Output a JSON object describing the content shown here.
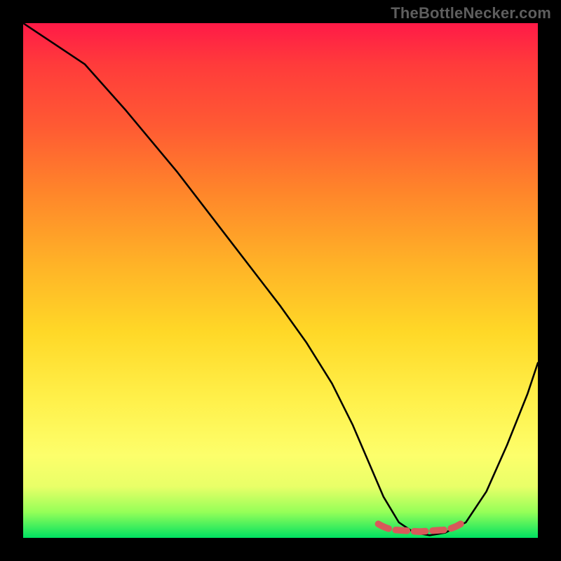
{
  "watermark": "TheBottleNecker.com",
  "chart_data": {
    "type": "line",
    "title": "",
    "xlabel": "",
    "ylabel": "",
    "xlim": [
      0,
      100
    ],
    "ylim": [
      0,
      100
    ],
    "series": [
      {
        "name": "bottleneck-curve",
        "x": [
          0,
          3,
          6,
          12,
          20,
          30,
          40,
          50,
          55,
          60,
          64,
          67,
          70,
          73,
          76,
          79,
          82,
          86,
          90,
          94,
          98,
          100
        ],
        "values": [
          100,
          98,
          96,
          92,
          83,
          71,
          58,
          45,
          38,
          30,
          22,
          15,
          8,
          3,
          1,
          0.5,
          1,
          3,
          9,
          18,
          28,
          34
        ]
      }
    ],
    "accent": {
      "name": "optimal-zone",
      "color": "#d85a5a",
      "x_range": [
        69,
        85
      ],
      "y_value": 1.5
    },
    "gradient_stops": [
      {
        "pos": 0,
        "color": "#ff1a47"
      },
      {
        "pos": 8,
        "color": "#ff3b3b"
      },
      {
        "pos": 20,
        "color": "#ff5a33"
      },
      {
        "pos": 33,
        "color": "#ff862a"
      },
      {
        "pos": 47,
        "color": "#ffb327"
      },
      {
        "pos": 60,
        "color": "#ffd827"
      },
      {
        "pos": 73,
        "color": "#fff04a"
      },
      {
        "pos": 84,
        "color": "#fdff6b"
      },
      {
        "pos": 90,
        "color": "#e9ff68"
      },
      {
        "pos": 95,
        "color": "#95ff58"
      },
      {
        "pos": 100,
        "color": "#00e161"
      }
    ]
  }
}
